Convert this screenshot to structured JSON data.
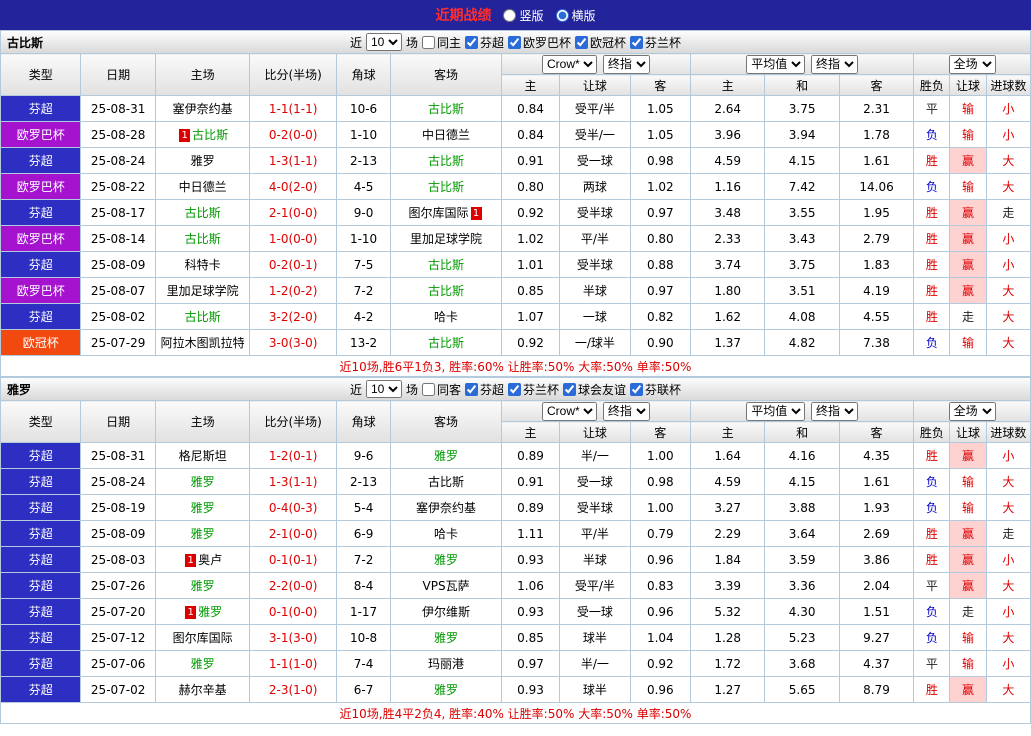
{
  "topbar": {
    "title": "近期战绩",
    "layout_options": [
      {
        "label": "竖版",
        "checked": false
      },
      {
        "label": "横版",
        "checked": true
      }
    ]
  },
  "table_header": {
    "static_cols": [
      "类型",
      "日期",
      "主场",
      "比分(半场)",
      "角球",
      "客场"
    ],
    "odds_source_select": "Crow*",
    "odds_final_select": "终指",
    "avg_select": "平均值",
    "avg_final_select": "终指",
    "scope_select": "全场",
    "sub_cols": [
      "主",
      "让球",
      "客",
      "主",
      "和",
      "客",
      "胜负",
      "让球",
      "进球数"
    ]
  },
  "badge_label": "1",
  "colors": {
    "topbar_bg": "#23239b",
    "title_red": "#ff2d2d",
    "result_red": "#dd0000",
    "result_blue": "#0000cc",
    "result_dark": "#222222",
    "win_highlight_bg": "#ffd2d2",
    "team_green": "#009900",
    "grid_border": "#b3c9dc",
    "accent_blue": "#2b6bd8",
    "type_colors": {
      "芬超": "#2d2fc2",
      "欧罗巴杯": "#a613cf",
      "欧冠杯": "#f1490f"
    }
  },
  "sections": [
    {
      "team": "古比斯",
      "filter": {
        "prefix": "近",
        "count": "10",
        "suffix": "场",
        "same_label": "同主",
        "same_checked": false,
        "leagues": [
          {
            "label": "芬超",
            "checked": true
          },
          {
            "label": "欧罗巴杯",
            "checked": true
          },
          {
            "label": "欧冠杯",
            "checked": true
          },
          {
            "label": "芬兰杯",
            "checked": true
          }
        ]
      },
      "rows": [
        {
          "type": "芬超",
          "date": "25-08-31",
          "home": "塞伊奈约基",
          "home_green": false,
          "home_badge": false,
          "score": "1-1",
          "half": "(1-1)",
          "corners": "10-6",
          "away": "古比斯",
          "away_green": true,
          "away_badge": false,
          "ah": [
            "0.84",
            "受平/半",
            "1.05"
          ],
          "eu": [
            "2.64",
            "3.75",
            "2.31"
          ],
          "res": [
            "平",
            "输",
            "小"
          ]
        },
        {
          "type": "欧罗巴杯",
          "date": "25-08-28",
          "home": "古比斯",
          "home_green": true,
          "home_badge": true,
          "score": "0-2",
          "half": "(0-0)",
          "corners": "1-10",
          "away": "中日德兰",
          "away_green": false,
          "away_badge": false,
          "ah": [
            "0.84",
            "受半/一",
            "1.05"
          ],
          "eu": [
            "3.96",
            "3.94",
            "1.78"
          ],
          "res": [
            "负",
            "输",
            "小"
          ]
        },
        {
          "type": "芬超",
          "date": "25-08-24",
          "home": "雅罗",
          "home_green": false,
          "home_badge": false,
          "score": "1-3",
          "half": "(1-1)",
          "corners": "2-13",
          "away": "古比斯",
          "away_green": true,
          "away_badge": false,
          "ah": [
            "0.91",
            "受一球",
            "0.98"
          ],
          "eu": [
            "4.59",
            "4.15",
            "1.61"
          ],
          "res": [
            "胜",
            "赢",
            "大"
          ]
        },
        {
          "type": "欧罗巴杯",
          "date": "25-08-22",
          "home": "中日德兰",
          "home_green": false,
          "home_badge": false,
          "score": "4-0",
          "half": "(2-0)",
          "corners": "4-5",
          "away": "古比斯",
          "away_green": true,
          "away_badge": false,
          "ah": [
            "0.80",
            "两球",
            "1.02"
          ],
          "eu": [
            "1.16",
            "7.42",
            "14.06"
          ],
          "res": [
            "负",
            "输",
            "大"
          ]
        },
        {
          "type": "芬超",
          "date": "25-08-17",
          "home": "古比斯",
          "home_green": true,
          "home_badge": false,
          "score": "2-1",
          "half": "(0-0)",
          "corners": "9-0",
          "away": "图尔库国际",
          "away_green": false,
          "away_badge": true,
          "ah": [
            "0.92",
            "受半球",
            "0.97"
          ],
          "eu": [
            "3.48",
            "3.55",
            "1.95"
          ],
          "res": [
            "胜",
            "赢",
            "走"
          ]
        },
        {
          "type": "欧罗巴杯",
          "date": "25-08-14",
          "home": "古比斯",
          "home_green": true,
          "home_badge": false,
          "score": "1-0",
          "half": "(0-0)",
          "corners": "1-10",
          "away": "里加足球学院",
          "away_green": false,
          "away_badge": false,
          "ah": [
            "1.02",
            "平/半",
            "0.80"
          ],
          "eu": [
            "2.33",
            "3.43",
            "2.79"
          ],
          "res": [
            "胜",
            "赢",
            "小"
          ]
        },
        {
          "type": "芬超",
          "date": "25-08-09",
          "home": "科特卡",
          "home_green": false,
          "home_badge": false,
          "score": "0-2",
          "half": "(0-1)",
          "corners": "7-5",
          "away": "古比斯",
          "away_green": true,
          "away_badge": false,
          "ah": [
            "1.01",
            "受半球",
            "0.88"
          ],
          "eu": [
            "3.74",
            "3.75",
            "1.83"
          ],
          "res": [
            "胜",
            "赢",
            "小"
          ]
        },
        {
          "type": "欧罗巴杯",
          "date": "25-08-07",
          "home": "里加足球学院",
          "home_green": false,
          "home_badge": false,
          "score": "1-2",
          "half": "(0-2)",
          "corners": "7-2",
          "away": "古比斯",
          "away_green": true,
          "away_badge": false,
          "ah": [
            "0.85",
            "半球",
            "0.97"
          ],
          "eu": [
            "1.80",
            "3.51",
            "4.19"
          ],
          "res": [
            "胜",
            "赢",
            "大"
          ]
        },
        {
          "type": "芬超",
          "date": "25-08-02",
          "home": "古比斯",
          "home_green": true,
          "home_badge": false,
          "score": "3-2",
          "half": "(2-0)",
          "corners": "4-2",
          "away": "哈卡",
          "away_green": false,
          "away_badge": false,
          "ah": [
            "1.07",
            "一球",
            "0.82"
          ],
          "eu": [
            "1.62",
            "4.08",
            "4.55"
          ],
          "res": [
            "胜",
            "走",
            "大"
          ]
        },
        {
          "type": "欧冠杯",
          "date": "25-07-29",
          "home": "阿拉木图凯拉特",
          "home_green": false,
          "home_badge": false,
          "score": "3-0",
          "half": "(3-0)",
          "corners": "13-2",
          "away": "古比斯",
          "away_green": true,
          "away_badge": false,
          "ah": [
            "0.92",
            "一/球半",
            "0.90"
          ],
          "eu": [
            "1.37",
            "4.82",
            "7.38"
          ],
          "res": [
            "负",
            "输",
            "大"
          ]
        }
      ],
      "summary": "近10场,胜6平1负3, 胜率:60% 让胜率:50% 大率:50% 单率:50%"
    },
    {
      "team": "雅罗",
      "filter": {
        "prefix": "近",
        "count": "10",
        "suffix": "场",
        "same_label": "同客",
        "same_checked": false,
        "leagues": [
          {
            "label": "芬超",
            "checked": true
          },
          {
            "label": "芬兰杯",
            "checked": true
          },
          {
            "label": "球会友谊",
            "checked": true
          },
          {
            "label": "芬联杯",
            "checked": true
          }
        ]
      },
      "rows": [
        {
          "type": "芬超",
          "date": "25-08-31",
          "home": "格尼斯坦",
          "home_green": false,
          "home_badge": false,
          "score": "1-2",
          "half": "(0-1)",
          "corners": "9-6",
          "away": "雅罗",
          "away_green": true,
          "away_badge": false,
          "ah": [
            "0.89",
            "半/一",
            "1.00"
          ],
          "eu": [
            "1.64",
            "4.16",
            "4.35"
          ],
          "res": [
            "胜",
            "赢",
            "小"
          ]
        },
        {
          "type": "芬超",
          "date": "25-08-24",
          "home": "雅罗",
          "home_green": true,
          "home_badge": false,
          "score": "1-3",
          "half": "(1-1)",
          "corners": "2-13",
          "away": "古比斯",
          "away_green": false,
          "away_badge": false,
          "ah": [
            "0.91",
            "受一球",
            "0.98"
          ],
          "eu": [
            "4.59",
            "4.15",
            "1.61"
          ],
          "res": [
            "负",
            "输",
            "大"
          ]
        },
        {
          "type": "芬超",
          "date": "25-08-19",
          "home": "雅罗",
          "home_green": true,
          "home_badge": false,
          "score": "0-4",
          "half": "(0-3)",
          "corners": "5-4",
          "away": "塞伊奈约基",
          "away_green": false,
          "away_badge": false,
          "ah": [
            "0.89",
            "受半球",
            "1.00"
          ],
          "eu": [
            "3.27",
            "3.88",
            "1.93"
          ],
          "res": [
            "负",
            "输",
            "大"
          ]
        },
        {
          "type": "芬超",
          "date": "25-08-09",
          "home": "雅罗",
          "home_green": true,
          "home_badge": false,
          "score": "2-1",
          "half": "(0-0)",
          "corners": "6-9",
          "away": "哈卡",
          "away_green": false,
          "away_badge": false,
          "ah": [
            "1.11",
            "平/半",
            "0.79"
          ],
          "eu": [
            "2.29",
            "3.64",
            "2.69"
          ],
          "res": [
            "胜",
            "赢",
            "走"
          ]
        },
        {
          "type": "芬超",
          "date": "25-08-03",
          "home": "奥卢",
          "home_green": false,
          "home_badge": true,
          "score": "0-1",
          "half": "(0-1)",
          "corners": "7-2",
          "away": "雅罗",
          "away_green": true,
          "away_badge": false,
          "ah": [
            "0.93",
            "半球",
            "0.96"
          ],
          "eu": [
            "1.84",
            "3.59",
            "3.86"
          ],
          "res": [
            "胜",
            "赢",
            "小"
          ]
        },
        {
          "type": "芬超",
          "date": "25-07-26",
          "home": "雅罗",
          "home_green": true,
          "home_badge": false,
          "score": "2-2",
          "half": "(0-0)",
          "corners": "8-4",
          "away": "VPS瓦萨",
          "away_green": false,
          "away_badge": false,
          "ah": [
            "1.06",
            "受平/半",
            "0.83"
          ],
          "eu": [
            "3.39",
            "3.36",
            "2.04"
          ],
          "res": [
            "平",
            "赢",
            "大"
          ]
        },
        {
          "type": "芬超",
          "date": "25-07-20",
          "home": "雅罗",
          "home_green": true,
          "home_badge": true,
          "score": "0-1",
          "half": "(0-0)",
          "corners": "1-17",
          "away": "伊尔维斯",
          "away_green": false,
          "away_badge": false,
          "ah": [
            "0.93",
            "受一球",
            "0.96"
          ],
          "eu": [
            "5.32",
            "4.30",
            "1.51"
          ],
          "res": [
            "负",
            "走",
            "小"
          ]
        },
        {
          "type": "芬超",
          "date": "25-07-12",
          "home": "图尔库国际",
          "home_green": false,
          "home_badge": false,
          "score": "3-1",
          "half": "(3-0)",
          "corners": "10-8",
          "away": "雅罗",
          "away_green": true,
          "away_badge": false,
          "ah": [
            "0.85",
            "球半",
            "1.04"
          ],
          "eu": [
            "1.28",
            "5.23",
            "9.27"
          ],
          "res": [
            "负",
            "输",
            "大"
          ]
        },
        {
          "type": "芬超",
          "date": "25-07-06",
          "home": "雅罗",
          "home_green": true,
          "home_badge": false,
          "score": "1-1",
          "half": "(1-0)",
          "corners": "7-4",
          "away": "玛丽港",
          "away_green": false,
          "away_badge": false,
          "ah": [
            "0.97",
            "半/一",
            "0.92"
          ],
          "eu": [
            "1.72",
            "3.68",
            "4.37"
          ],
          "res": [
            "平",
            "输",
            "小"
          ]
        },
        {
          "type": "芬超",
          "date": "25-07-02",
          "home": "赫尔辛基",
          "home_green": false,
          "home_badge": false,
          "score": "2-3",
          "half": "(1-0)",
          "corners": "6-7",
          "away": "雅罗",
          "away_green": true,
          "away_badge": false,
          "ah": [
            "0.93",
            "球半",
            "0.96"
          ],
          "eu": [
            "1.27",
            "5.65",
            "8.79"
          ],
          "res": [
            "胜",
            "赢",
            "大"
          ]
        }
      ],
      "summary": "近10场,胜4平2负4, 胜率:40% 让胜率:50% 大率:50% 单率:50%"
    }
  ]
}
